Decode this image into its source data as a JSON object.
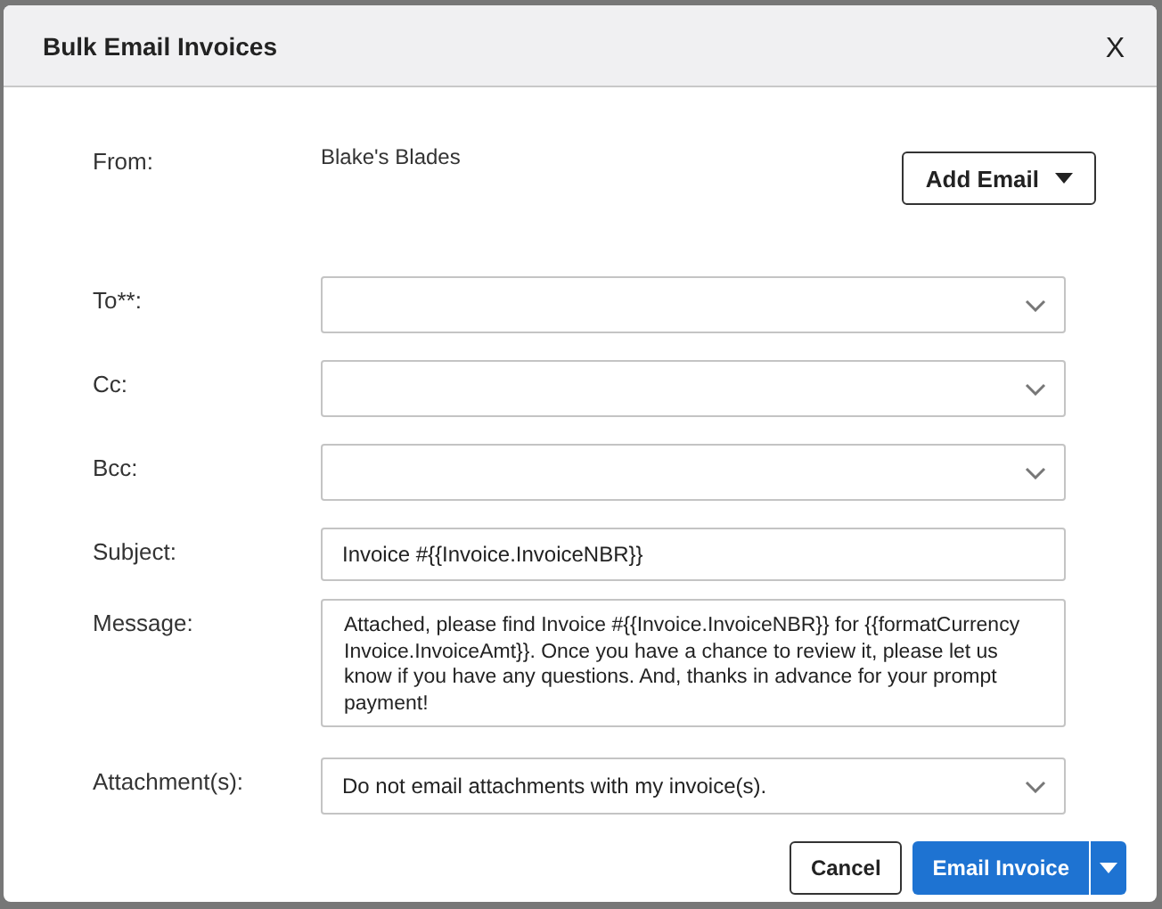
{
  "dialog": {
    "title": "Bulk Email Invoices",
    "close": "X"
  },
  "from": {
    "label": "From:",
    "value": "Blake's Blades"
  },
  "add_email_button": {
    "label": "Add Email"
  },
  "fields": [
    {
      "kind": "select",
      "label": "To**:"
    },
    {
      "kind": "select",
      "label": "Cc:"
    },
    {
      "kind": "select",
      "label": "Bcc:"
    },
    {
      "kind": "text",
      "label": "Subject:",
      "value": "Invoice #{{Invoice.InvoiceNBR}}"
    },
    {
      "kind": "textarea",
      "label": "Message:",
      "value": "Attached, please find Invoice #{{Invoice.InvoiceNBR}} for {{formatCurrency Invoice.InvoiceAmt}}.  Once you have a chance to review it, please let us know if you have any questions.  And, thanks in advance for your prompt payment!"
    },
    {
      "kind": "select",
      "label": "Attachment(s):",
      "value": "Do not email attachments with my invoice(s)."
    }
  ],
  "buttons": {
    "cancel": "Cancel",
    "primary": "Email Invoice"
  }
}
